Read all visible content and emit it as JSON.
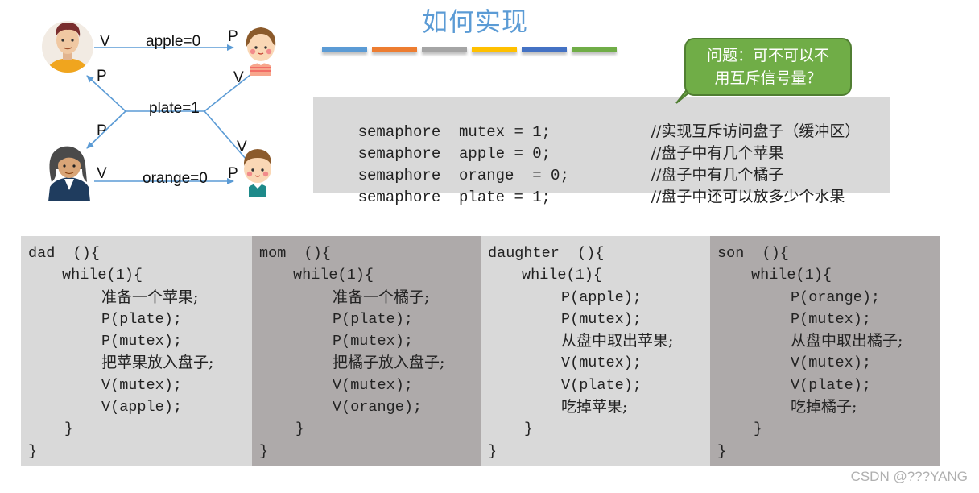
{
  "diagram": {
    "edges": {
      "apple": "apple=0",
      "plate": "plate=1",
      "orange": "orange=0"
    },
    "ops": {
      "dad_apple": "V",
      "daughter_apple": "P",
      "dad_plate": "P",
      "mom_plate": "P",
      "daughter_plate": "V",
      "son_plate": "V",
      "mom_orange": "V",
      "son_orange": "P"
    },
    "people": [
      "dad",
      "daughter",
      "mom",
      "son"
    ],
    "line_color": "#5b9bd5"
  },
  "title": "如何实现",
  "color_bars": [
    "#5b9bd5",
    "#ed7d31",
    "#a5a5a5",
    "#ffc000",
    "#4472c4",
    "#70ad47"
  ],
  "callout": {
    "line1": "问题：可不可以不",
    "line2": "用互斥信号量？",
    "color": "#70ad47"
  },
  "semaphores": [
    {
      "code": "semaphore  mutex = 1;",
      "comment": "//实现互斥访问盘子（缓冲区）"
    },
    {
      "code": "semaphore  apple = 0;",
      "comment": "//盘子中有几个苹果"
    },
    {
      "code": "semaphore  orange  = 0;",
      "comment": "//盘子中有几个橘子"
    },
    {
      "code": "semaphore  plate = 1;",
      "comment": "//盘子中还可以放多少个水果"
    }
  ],
  "processes": [
    {
      "name": "dad",
      "header": "dad  (){",
      "loop": "while(1){",
      "body": [
        "准备一个苹果;",
        "P(plate);",
        "P(mutex);",
        "把苹果放入盘子;",
        "V(mutex);",
        "V(apple);"
      ],
      "close_inner": "}",
      "close_outer": "}"
    },
    {
      "name": "mom",
      "header": "mom  (){",
      "loop": "while(1){",
      "body": [
        "准备一个橘子;",
        "P(plate);",
        "P(mutex);",
        "把橘子放入盘子;",
        "V(mutex);",
        "V(orange);"
      ],
      "close_inner": "}",
      "close_outer": "}"
    },
    {
      "name": "daughter",
      "header": "daughter  (){",
      "loop": "while(1){",
      "body": [
        "P(apple);",
        "P(mutex);",
        "从盘中取出苹果;",
        "V(mutex);",
        "V(plate);",
        "吃掉苹果;"
      ],
      "close_inner": "}",
      "close_outer": "}"
    },
    {
      "name": "son",
      "header": "son  (){",
      "loop": "while(1){",
      "body": [
        "P(orange);",
        "P(mutex);",
        "从盘中取出橘子;",
        "V(mutex);",
        "V(plate);",
        "吃掉橘子;"
      ],
      "close_inner": "}",
      "close_outer": "}"
    }
  ],
  "watermark": "CSDN @???YANG"
}
